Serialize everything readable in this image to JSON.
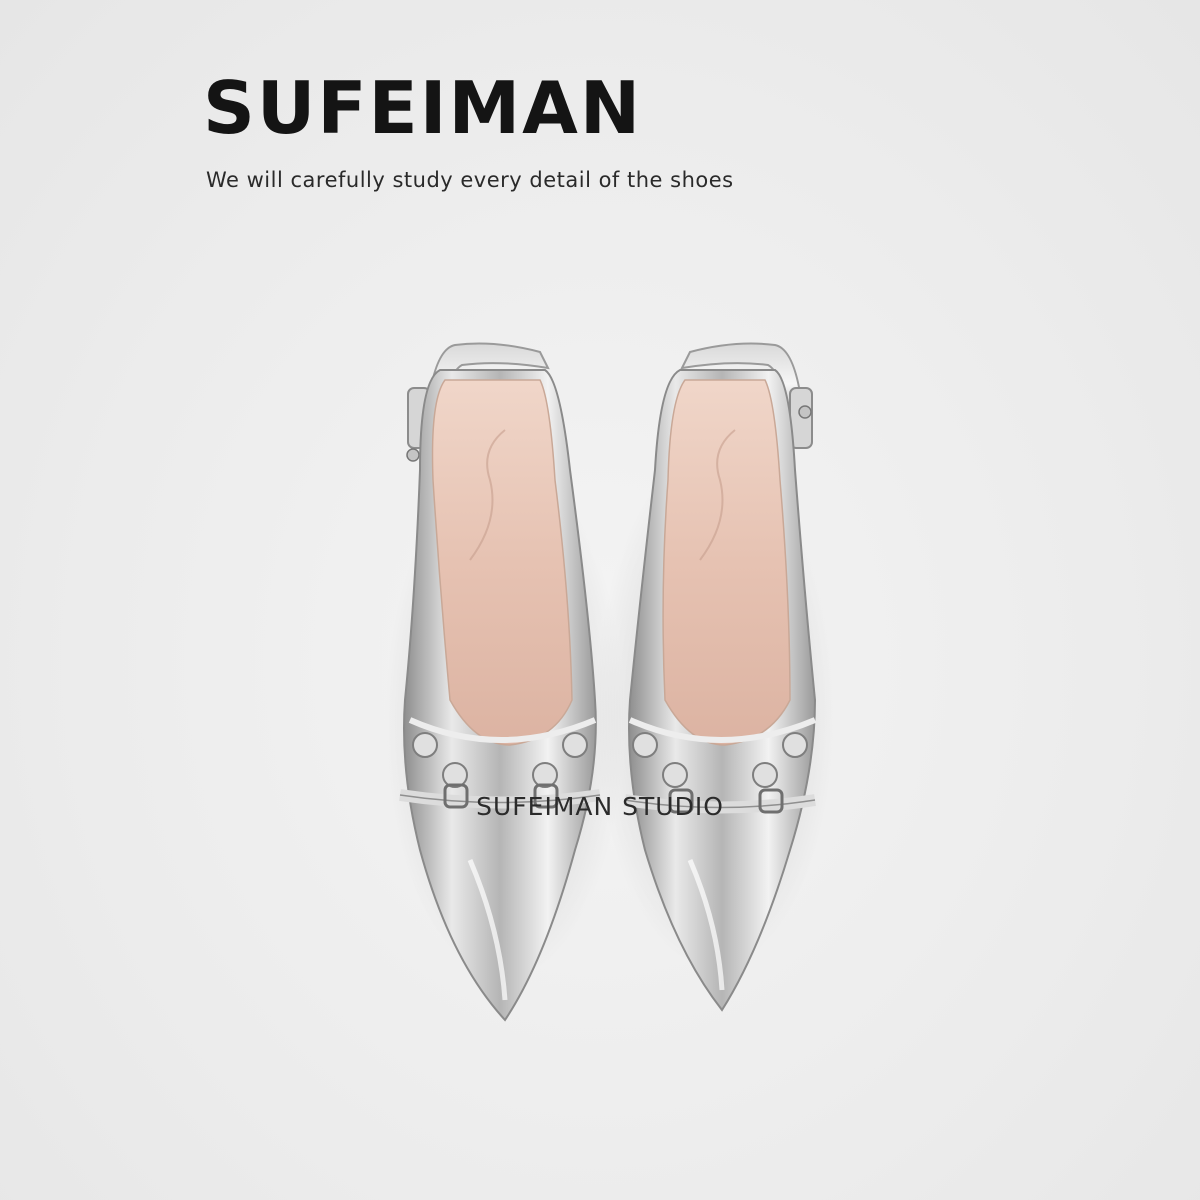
{
  "brand": {
    "title": "SUFEIMAN",
    "tagline": "We will carefully study every detail of the shoes",
    "studio": "SUFEIMAN STUDIO"
  },
  "product": {
    "image_icon": "silver-slingback-heels-photo",
    "colors": {
      "background": "#eeeeee",
      "metal": "#c9c9c9",
      "lining": "#e8c9bb"
    }
  }
}
